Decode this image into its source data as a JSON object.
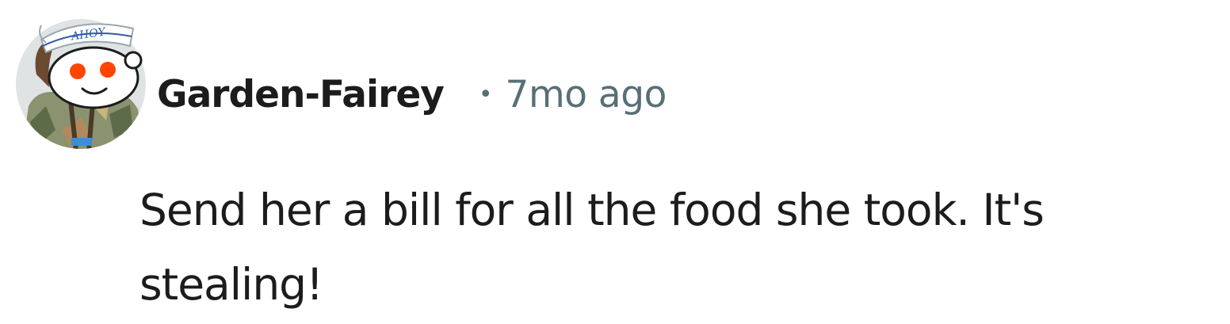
{
  "comment": {
    "author": {
      "username": "Garden-Fairey",
      "avatar_icon": "snoo-avatar-icon",
      "hat_text": "AHOY"
    },
    "separator": "•",
    "timestamp": "7mo ago",
    "body": "Send her a bill for all the food she took. It's stealing!"
  },
  "colors": {
    "username": "#1c1c1c",
    "timestamp": "#576f76",
    "body_text": "#1c1c1c",
    "avatar_eye": "#ff4500"
  }
}
